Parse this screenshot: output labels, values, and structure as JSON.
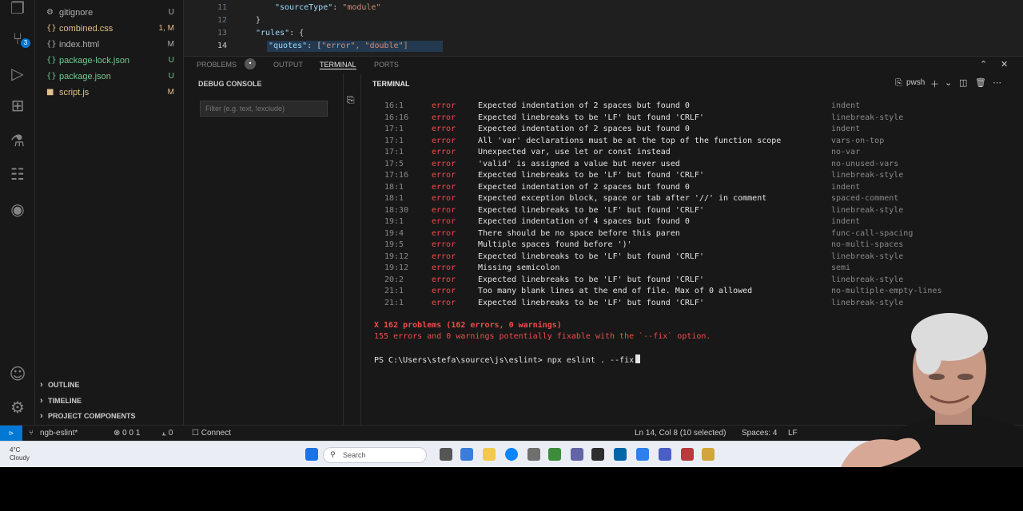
{
  "explorer": {
    "files": [
      {
        "name": "gitignore",
        "count": "U",
        "color": "#b0b0b0",
        "icon": "gear-icon"
      },
      {
        "name": "combined.css",
        "count": "1, M",
        "color": "#e2c08d",
        "icon": "css-file-icon"
      },
      {
        "name": "index.html",
        "count": "M",
        "color": "#b0b0b0",
        "icon": "html-file-icon"
      },
      {
        "name": "package-lock.json",
        "count": "U",
        "color": "#73c991",
        "icon": "json-file-icon"
      },
      {
        "name": "package.json",
        "count": "U",
        "color": "#73c991",
        "icon": "json-file-icon"
      },
      {
        "name": "script.js",
        "count": "M",
        "color": "#e2c08d",
        "icon": "js-file-icon"
      }
    ],
    "sections": [
      "Outline",
      "Timeline",
      "Project Components"
    ]
  },
  "editor": {
    "line_numbers": [
      "11",
      "12",
      "13",
      "14"
    ],
    "lines": [
      {
        "key": "\"sourceType\"",
        "sep": ": ",
        "val": "\"module\""
      },
      {
        "key": "}",
        "sep": "",
        "val": ""
      },
      {
        "key": "\"rules\"",
        "sep": ": {",
        "val": ""
      },
      {
        "key": "\"quotes\"",
        "sep": ": [",
        "val": "\"error\", \"double\"]"
      }
    ]
  },
  "panel": {
    "tabs": [
      "Problems",
      "Output",
      "Terminal",
      "Ports"
    ],
    "active_tab": "Terminal"
  },
  "debug_console": {
    "title": "Debug Console",
    "filter_placeholder": "Filter (e.g. text, !exclude)"
  },
  "terminal": {
    "title": "Terminal",
    "shell": "pwsh",
    "lint_rows": [
      {
        "loc": "16:1",
        "sev": "error",
        "msg": "Expected indentation of 2 spaces but found 0",
        "rule": "indent"
      },
      {
        "loc": "16:16",
        "sev": "error",
        "msg": "Expected linebreaks to be 'LF' but found 'CRLF'",
        "rule": "linebreak-style"
      },
      {
        "loc": "17:1",
        "sev": "error",
        "msg": "Expected indentation of 2 spaces but found 0",
        "rule": "indent"
      },
      {
        "loc": "17:1",
        "sev": "error",
        "msg": "All 'var' declarations must be at the top of the function scope",
        "rule": "vars-on-top"
      },
      {
        "loc": "17:1",
        "sev": "error",
        "msg": "Unexpected var, use let or const instead",
        "rule": "no-var"
      },
      {
        "loc": "17:5",
        "sev": "error",
        "msg": "'valid' is assigned a value but never used",
        "rule": "no-unused-vars"
      },
      {
        "loc": "17:16",
        "sev": "error",
        "msg": "Expected linebreaks to be 'LF' but found 'CRLF'",
        "rule": "linebreak-style"
      },
      {
        "loc": "18:1",
        "sev": "error",
        "msg": "Expected indentation of 2 spaces but found 0",
        "rule": "indent"
      },
      {
        "loc": "18:1",
        "sev": "error",
        "msg": "Expected exception block, space or tab after '//' in comment",
        "rule": "spaced-comment"
      },
      {
        "loc": "18:30",
        "sev": "error",
        "msg": "Expected linebreaks to be 'LF' but found 'CRLF'",
        "rule": "linebreak-style"
      },
      {
        "loc": "19:1",
        "sev": "error",
        "msg": "Expected indentation of 4 spaces but found 0",
        "rule": "indent"
      },
      {
        "loc": "19:4",
        "sev": "error",
        "msg": "There should be no space before this paren",
        "rule": "func-call-spacing"
      },
      {
        "loc": "19:5",
        "sev": "error",
        "msg": "Multiple spaces found before ')'",
        "rule": "no-multi-spaces"
      },
      {
        "loc": "19:12",
        "sev": "error",
        "msg": "Expected linebreaks to be 'LF' but found 'CRLF'",
        "rule": "linebreak-style"
      },
      {
        "loc": "19:12",
        "sev": "error",
        "msg": "Missing semicolon",
        "rule": "semi"
      },
      {
        "loc": "20:2",
        "sev": "error",
        "msg": "Expected linebreaks to be 'LF' but found 'CRLF'",
        "rule": "linebreak-style"
      },
      {
        "loc": "21:1",
        "sev": "error",
        "msg": "Too many blank lines at the end of file. Max of 0 allowed",
        "rule": "no-multiple-empty-lines"
      },
      {
        "loc": "21:1",
        "sev": "error",
        "msg": "Expected linebreaks to be 'LF' but found 'CRLF'",
        "rule": "linebreak-style"
      }
    ],
    "summary_problems": "X 162 problems (162 errors, 0 warnings)",
    "summary_fixable": "  155 errors and 0 warnings potentially fixable with the `--fix` option.",
    "prompt": "PS C:\\Users\\stefa\\source\\js\\eslint> npx eslint . --fix"
  },
  "statusbar": {
    "branch": "ngb-eslint*",
    "problems": "0 0  1",
    "ports": "0",
    "connect": "Connect",
    "cursor": "Ln 14, Col 8 (10 selected)",
    "spaces": "Spaces: 4",
    "eol": "LF"
  },
  "taskbar": {
    "weather_temp": "4°C",
    "weather_text": "Cloudy",
    "search_placeholder": "Search"
  },
  "colors": {
    "error_red": "#f14c4c",
    "accent_blue": "#0078d4"
  }
}
